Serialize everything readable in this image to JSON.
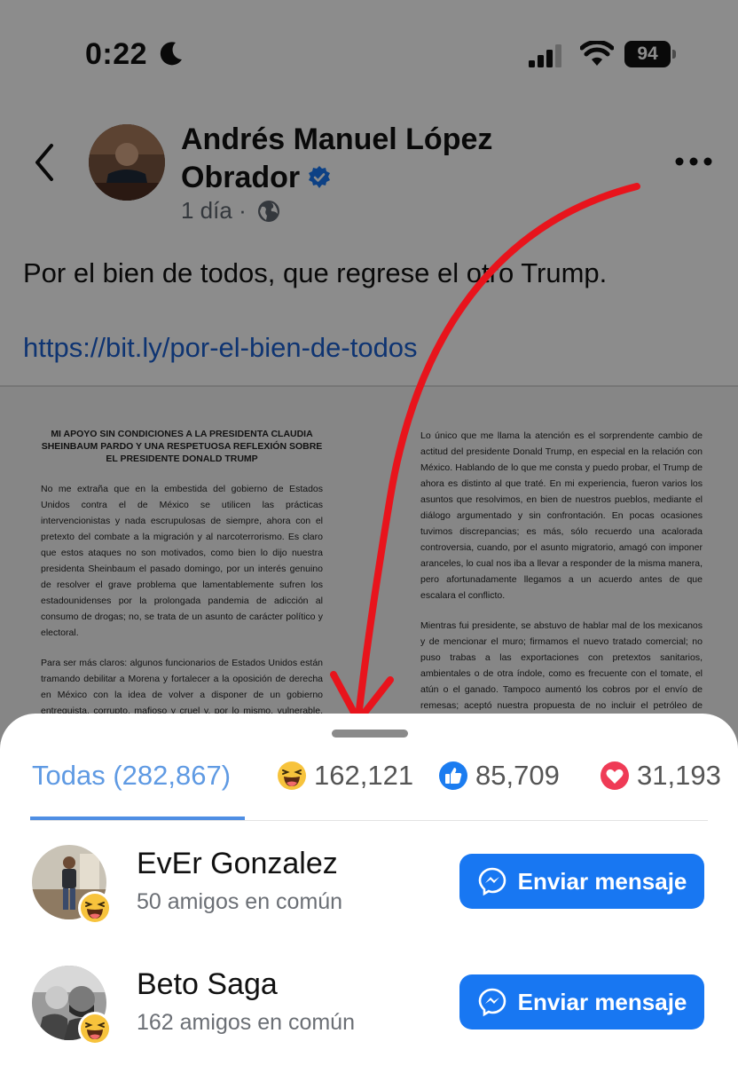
{
  "status_bar": {
    "time": "0:22",
    "battery": "94"
  },
  "post": {
    "author_line1": "Andrés Manuel López",
    "author_line2": "Obrador",
    "time_ago": "1 día",
    "separator": "·",
    "text": "Por el bien de todos, que regrese el otro Trump.",
    "link": "https://bit.ly/por-el-bien-de-todos"
  },
  "article": {
    "title": "MI APOYO SIN CONDICIONES A LA PRESIDENTA CLAUDIA SHEINBAUM PARDO Y UNA RESPETUOSA REFLEXIÓN SOBRE EL PRESIDENTE DONALD TRUMP",
    "left_paragraphs": [
      "No me extraña que en la embestida del gobierno de Estados Unidos contra el de México se utilicen las prácticas intervencionistas y nada escrupulosas de siempre, ahora con el pretexto del combate a la migración y al narcoterrorismo. Es claro que estos ataques no son motivados, como bien lo dijo nuestra presidenta Sheinbaum el pasado domingo, por un interés genuino de resolver el grave problema que lamentablemente sufren los estadounidenses por la prolongada pandemia de adicción al consumo de drogas; no, se trata de un asunto de carácter político y electoral.",
      "Para ser más claros: algunos funcionarios de Estados Unidos están tramando debilitar a Morena y fortalecer a la oposición de derecha en México con la idea de volver a disponer de un gobierno entreguista, corrupto, mafioso y cruel y, por lo mismo, vulnerable, subordinado y fiel a sus designios intervencionistas. Además, confían en que podrán"
    ],
    "right_paragraphs": [
      "Lo único que me llama la atención es el sorprendente cambio de actitud del presidente Donald Trump, en especial en la relación con México. Hablando de lo que me consta y puedo probar, el Trump de ahora es distinto al que traté. En mi experiencia, fueron varios los asuntos que resolvimos, en bien de nuestros pueblos, mediante el diálogo argumentado y sin confrontación. En pocas ocasiones tuvimos discrepancias; es más, sólo recuerdo una acalorada controversia, cuando, por el asunto migratorio, amagó con imponer aranceles, lo cual nos iba a llevar a responder de la misma manera, pero afortunadamente llegamos a un acuerdo antes de que escalara el conflicto.",
      "Mientras fui presidente, se abstuvo de hablar mal de los mexicanos y de mencionar el muro; firmamos el nuevo tratado comercial; no puso trabas a las exportaciones con pretextos sanitarios, ambientales o de otra índole, como es frecuente con el tomate, el atún o el ganado. Tampoco aumentó los cobros por el envío de remesas; aceptó nuestra propuesta de no incluir el petróleo de México en el tratado, por respeto"
    ]
  },
  "reactions": {
    "all_label": "Todas (282,867)",
    "haha_count": "162,121",
    "like_count": "85,709",
    "love_count": "31,193"
  },
  "people": [
    {
      "name": "EvEr Gonzalez",
      "mutual": "50 amigos en común",
      "button": "Enviar mensaje"
    },
    {
      "name": "Beto Saga",
      "mutual": "162 amigos en común",
      "button": "Enviar mensaje"
    }
  ],
  "colors": {
    "accent": "#1877f2",
    "tab_active": "#5f9ae3",
    "arrow": "#e8141c"
  }
}
